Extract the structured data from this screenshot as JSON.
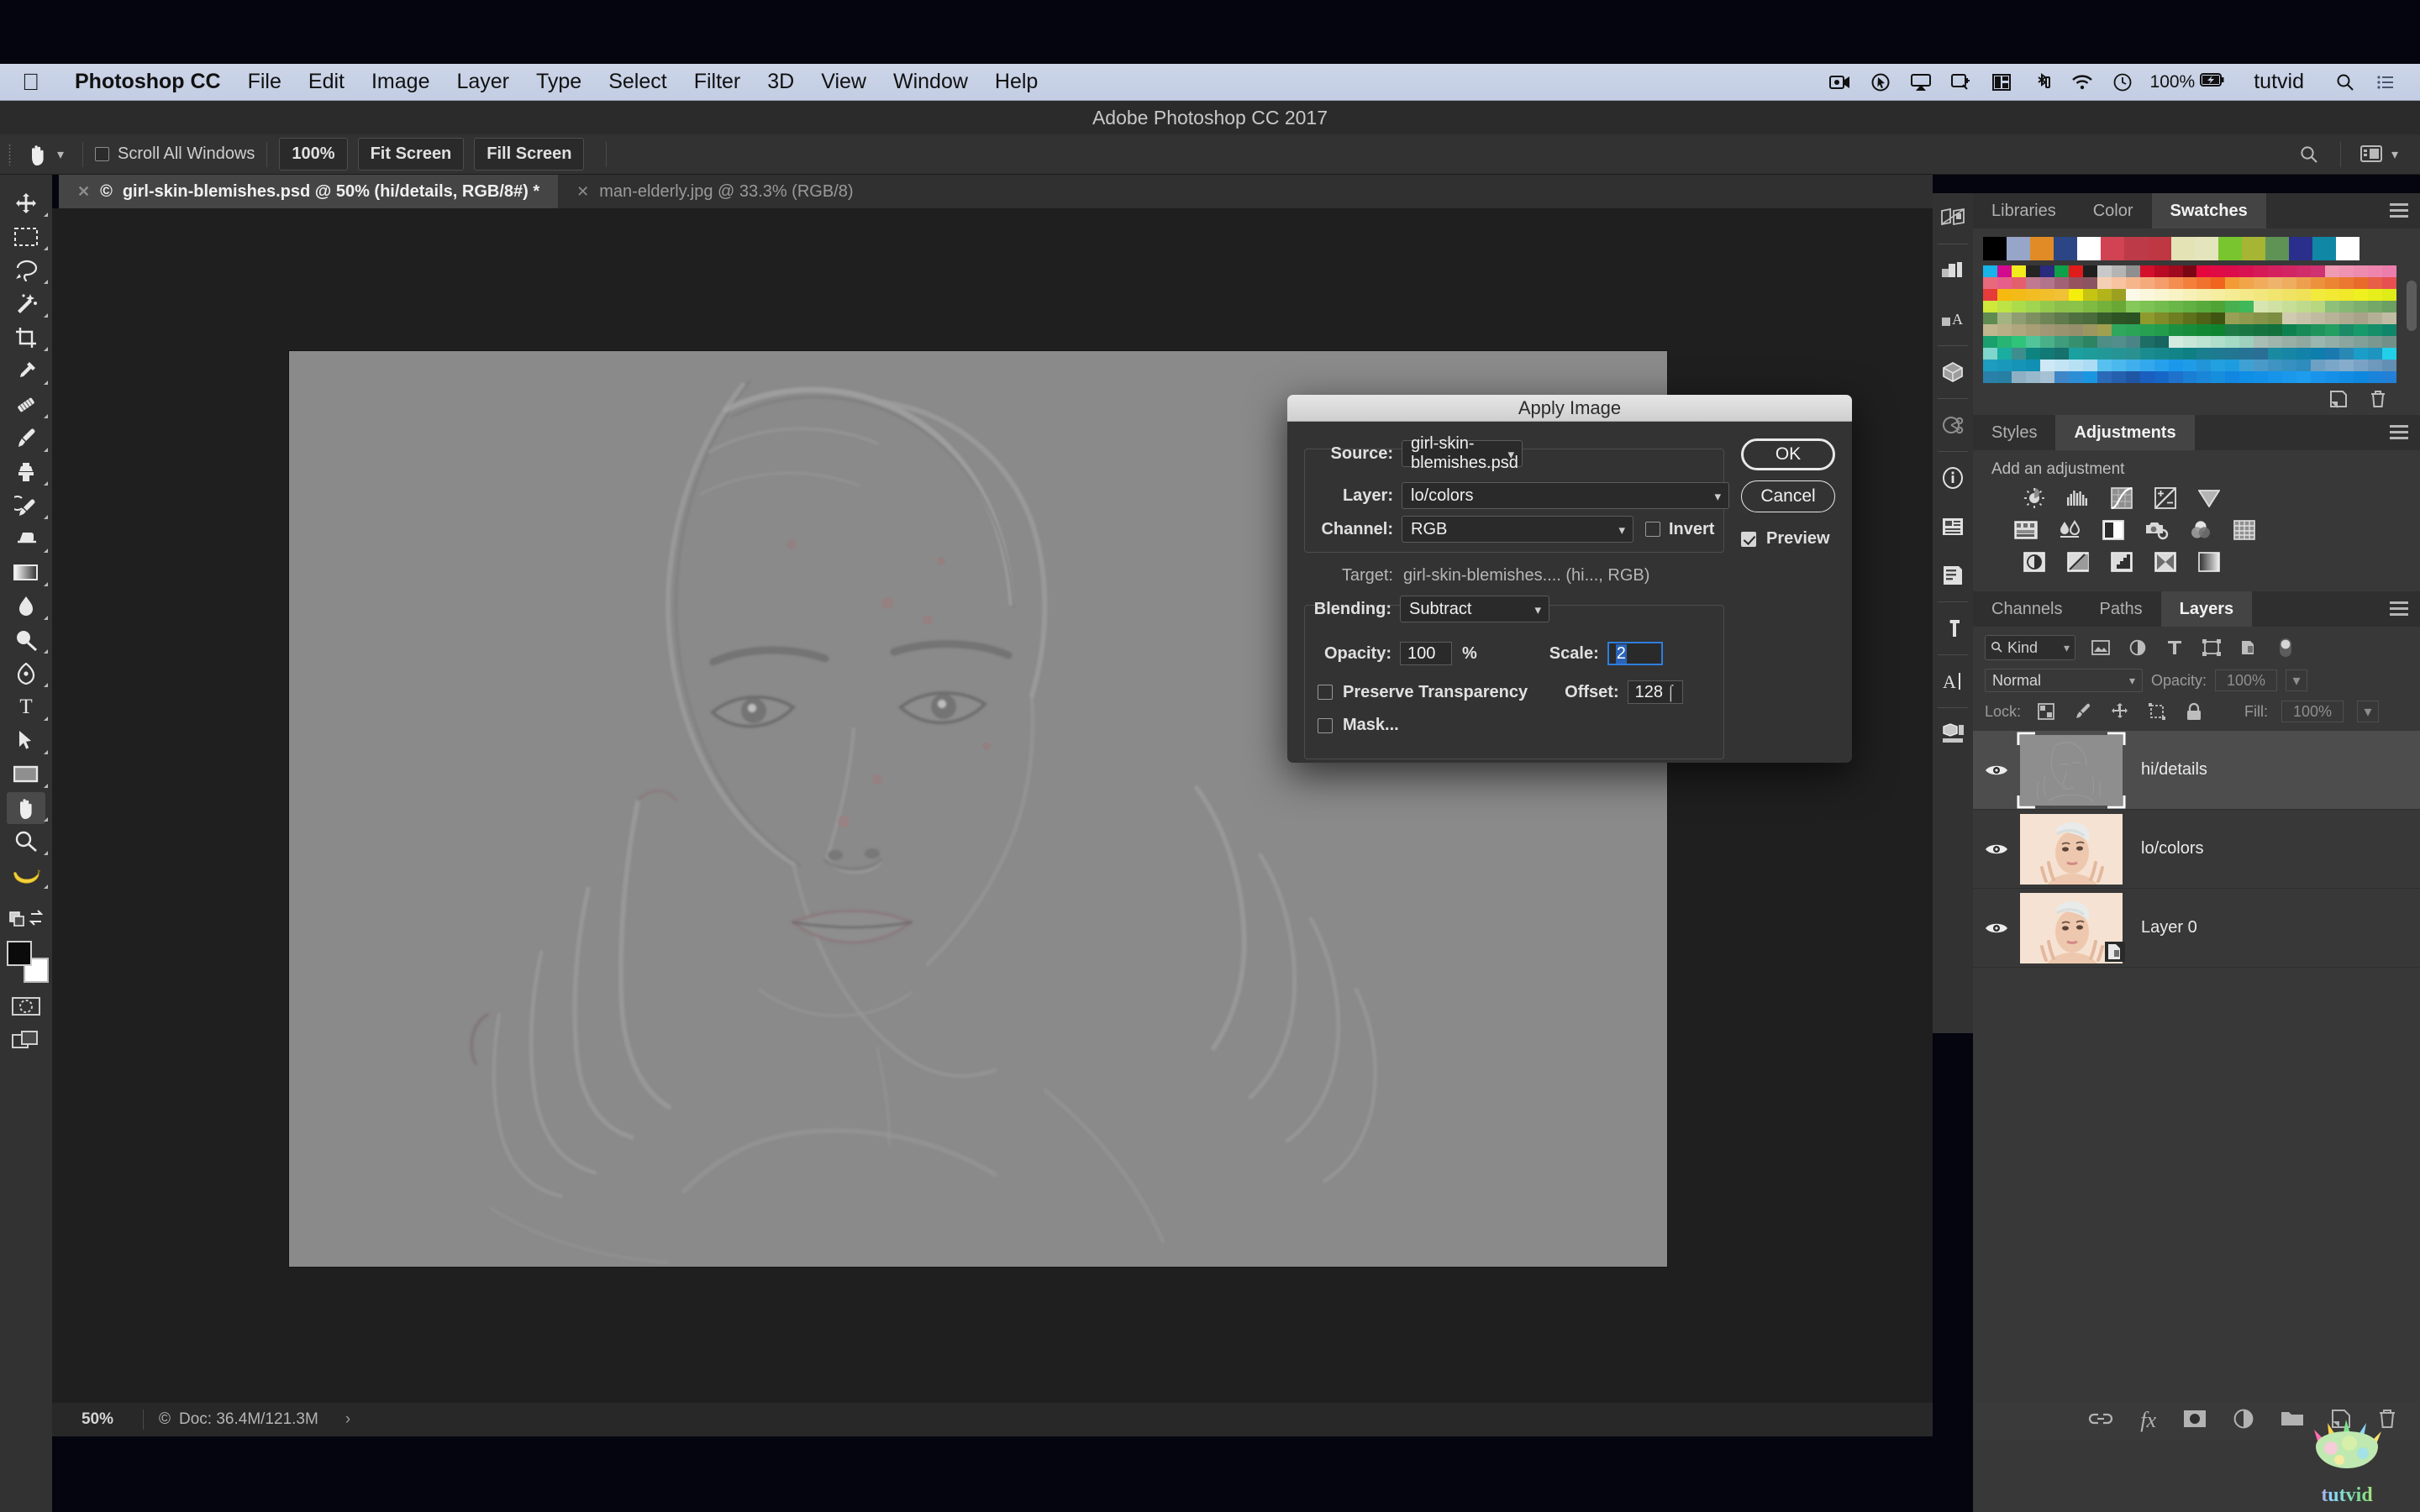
{
  "macbar": {
    "apple_icon": "apple-icon",
    "app_name": "Photoshop CC",
    "menus": [
      "File",
      "Edit",
      "Image",
      "Layer",
      "Type",
      "Select",
      "Filter",
      "3D",
      "View",
      "Window",
      "Help"
    ],
    "status_icons": [
      "screen-record-icon",
      "cursor-capture-icon",
      "airplay-icon",
      "display-connect-icon",
      "split-view-icon",
      "bluetooth-icon",
      "wifi-icon",
      "time-machine-icon"
    ],
    "battery_percent": "100%",
    "battery_icon": "battery-charging-icon",
    "user": "tutvid",
    "spotlight_icon": "search-icon",
    "notifications_icon": "notification-center-icon"
  },
  "window": {
    "title": "Adobe Photoshop CC 2017"
  },
  "options_bar": {
    "tool_icon": "hand-tool-icon",
    "preset_caret": "chevron-down-icon",
    "scroll_all_windows": {
      "label": "Scroll All Windows",
      "checked": false
    },
    "buttons": [
      "100%",
      "Fit Screen",
      "Fill Screen"
    ],
    "right_icons": [
      "search-icon",
      "workspace-icon",
      "chevron-down-icon"
    ]
  },
  "document_tabs": [
    {
      "label": "girl-skin-blemishes.psd @ 50% (hi/details, RGB/8#) *",
      "active": true,
      "close_icon": "close-icon",
      "color_profile_icon": "copyright-icon"
    },
    {
      "label": "man-elderly.jpg @ 33.3% (RGB/8)",
      "active": false,
      "close_icon": "close-icon"
    }
  ],
  "toolbar": {
    "tools": [
      {
        "name": "move-tool-icon",
        "selected": false
      },
      {
        "name": "rectangular-marquee-tool-icon",
        "selected": false
      },
      {
        "name": "lasso-tool-icon",
        "selected": false
      },
      {
        "name": "magic-wand-tool-icon",
        "selected": false
      },
      {
        "name": "crop-tool-icon",
        "selected": false
      },
      {
        "name": "eyedropper-tool-icon",
        "selected": false
      },
      {
        "name": "spot-healing-brush-tool-icon",
        "selected": false
      },
      {
        "name": "brush-tool-icon",
        "selected": false
      },
      {
        "name": "clone-stamp-tool-icon",
        "selected": false
      },
      {
        "name": "history-brush-tool-icon",
        "selected": false
      },
      {
        "name": "eraser-tool-icon",
        "selected": false
      },
      {
        "name": "gradient-tool-icon",
        "selected": false
      },
      {
        "name": "blur-tool-icon",
        "selected": false
      },
      {
        "name": "dodge-tool-icon",
        "selected": false
      },
      {
        "name": "pen-tool-icon",
        "selected": false
      },
      {
        "name": "type-tool-icon",
        "selected": false
      },
      {
        "name": "path-selection-tool-icon",
        "selected": false
      },
      {
        "name": "rectangle-tool-icon",
        "selected": false
      },
      {
        "name": "hand-tool-icon",
        "selected": true
      },
      {
        "name": "zoom-tool-icon",
        "selected": false
      },
      {
        "name": "banana-tool-icon",
        "selected": false
      }
    ],
    "edit_toolbar_icon": "edit-toolbar-icon",
    "swap_colors_icon": "swap-colors-icon",
    "default_colors_icon": "default-colors-icon",
    "foreground_color": "#0b0b0b",
    "background_color": "#ffffff",
    "quick_mask_icon": "quick-mask-icon",
    "screen_mode_icon": "screen-mode-icon"
  },
  "status_bar": {
    "zoom": "50%",
    "doc_icon": "copyright-icon",
    "doc_info": "Doc: 36.4M/121.3M",
    "expand_icon": "chevron-right-icon"
  },
  "rail_icons": [
    "3d-material-drop-icon",
    "layer-comps-icon",
    "glyphs-icon",
    "3d-icon",
    "measurement-log-icon",
    "info-icon",
    "properties-icon",
    "notes-icon",
    "paragraph-icon",
    "character-icon",
    "device-preview-icon"
  ],
  "panels": {
    "swatches_group": {
      "tabs": [
        {
          "label": "Libraries",
          "active": false
        },
        {
          "label": "Color",
          "active": false
        },
        {
          "label": "Swatches",
          "active": true
        }
      ],
      "menu_icon": "panel-menu-icon",
      "recent_colors": [
        "#000000",
        "#97a5c9",
        "#e08b25",
        "#2c4585",
        "#ffffff",
        "#d14252",
        "#bd3b48",
        "#bf3742",
        "#e3e3b5",
        "#e5e5bd",
        "#79c52f",
        "#a6b534",
        "#5f9356",
        "#2b2f8c",
        "#0f87a5",
        "#ffffff"
      ],
      "footer_icons": [
        "new-swatch-icon",
        "delete-swatch-icon"
      ],
      "scrollbar_icon": "vertical-scrollbar"
    },
    "adjustments_group": {
      "tabs": [
        {
          "label": "Styles",
          "active": false
        },
        {
          "label": "Adjustments",
          "active": true
        }
      ],
      "menu_icon": "panel-menu-icon",
      "heading": "Add an adjustment",
      "row1_icons": [
        "brightness-contrast-icon",
        "levels-icon",
        "curves-icon",
        "exposure-icon",
        "vibrance-icon"
      ],
      "row2_icons": [
        "hue-saturation-icon",
        "color-balance-icon",
        "black-white-icon",
        "photo-filter-icon",
        "channel-mixer-icon",
        "color-lookup-icon"
      ],
      "row3_icons": [
        "invert-icon",
        "posterize-icon",
        "threshold-icon",
        "selective-color-icon",
        "gradient-map-icon"
      ]
    },
    "layers_group": {
      "tabs": [
        {
          "label": "Channels",
          "active": false
        },
        {
          "label": "Paths",
          "active": false
        },
        {
          "label": "Layers",
          "active": true
        }
      ],
      "menu_icon": "panel-menu-icon",
      "filter": {
        "search_icon": "search-icon",
        "label": "Kind",
        "caret": "chevron-down-icon"
      },
      "filter_type_icons": [
        "filter-pixel-icon",
        "filter-adjustment-icon",
        "filter-type-icon",
        "filter-shape-icon",
        "filter-smart-object-icon"
      ],
      "filter_toggle_icon": "filter-toggle-icon",
      "blend_mode": "Normal",
      "opacity_label": "Opacity:",
      "opacity_value": "100%",
      "lock_label": "Lock:",
      "lock_icons": [
        "lock-transparent-pixels-icon",
        "lock-image-pixels-icon",
        "lock-position-icon",
        "lock-artboard-icon",
        "lock-all-icon"
      ],
      "fill_label": "Fill:",
      "fill_value": "100%",
      "layers": [
        {
          "name": "hi/details",
          "visible": true,
          "selected": true,
          "thumb": "highpass-gray",
          "visibility_icon": "eye-icon"
        },
        {
          "name": "lo/colors",
          "visible": true,
          "selected": false,
          "thumb": "portrait",
          "visibility_icon": "eye-icon"
        },
        {
          "name": "Layer 0",
          "visible": true,
          "selected": false,
          "thumb": "portrait",
          "visibility_icon": "eye-icon",
          "badge_icon": "smart-object-icon"
        }
      ],
      "footer_icons": [
        "link-layers-icon",
        "layer-style-fx-icon",
        "add-layer-mask-icon",
        "new-adjustment-layer-icon",
        "new-group-icon",
        "new-layer-icon",
        "delete-layer-icon"
      ],
      "fx_label": "fx"
    }
  },
  "dialog": {
    "title": "Apply Image",
    "source_label": "Source:",
    "source_value": "girl-skin-blemishes.psd",
    "layer_label": "Layer:",
    "layer_value": "lo/colors",
    "channel_label": "Channel:",
    "channel_value": "RGB",
    "invert_label": "Invert",
    "invert_checked": false,
    "target_label": "Target:",
    "target_value": "girl-skin-blemishes.... (hi..., RGB)",
    "blending_label": "Blending:",
    "blending_value": "Subtract",
    "opacity_label": "Opacity:",
    "opacity_value": "100",
    "opacity_unit": "%",
    "scale_label": "Scale:",
    "scale_value": "2",
    "offset_label": "Offset:",
    "offset_value": "128",
    "preserve_transparency_label": "Preserve Transparency",
    "preserve_transparency_checked": false,
    "mask_label": "Mask...",
    "mask_checked": false,
    "ok_label": "OK",
    "cancel_label": "Cancel",
    "preview_label": "Preview",
    "preview_checked": true,
    "accent_color": "#2e7fe0"
  },
  "watermark": {
    "text": "tutvid"
  }
}
